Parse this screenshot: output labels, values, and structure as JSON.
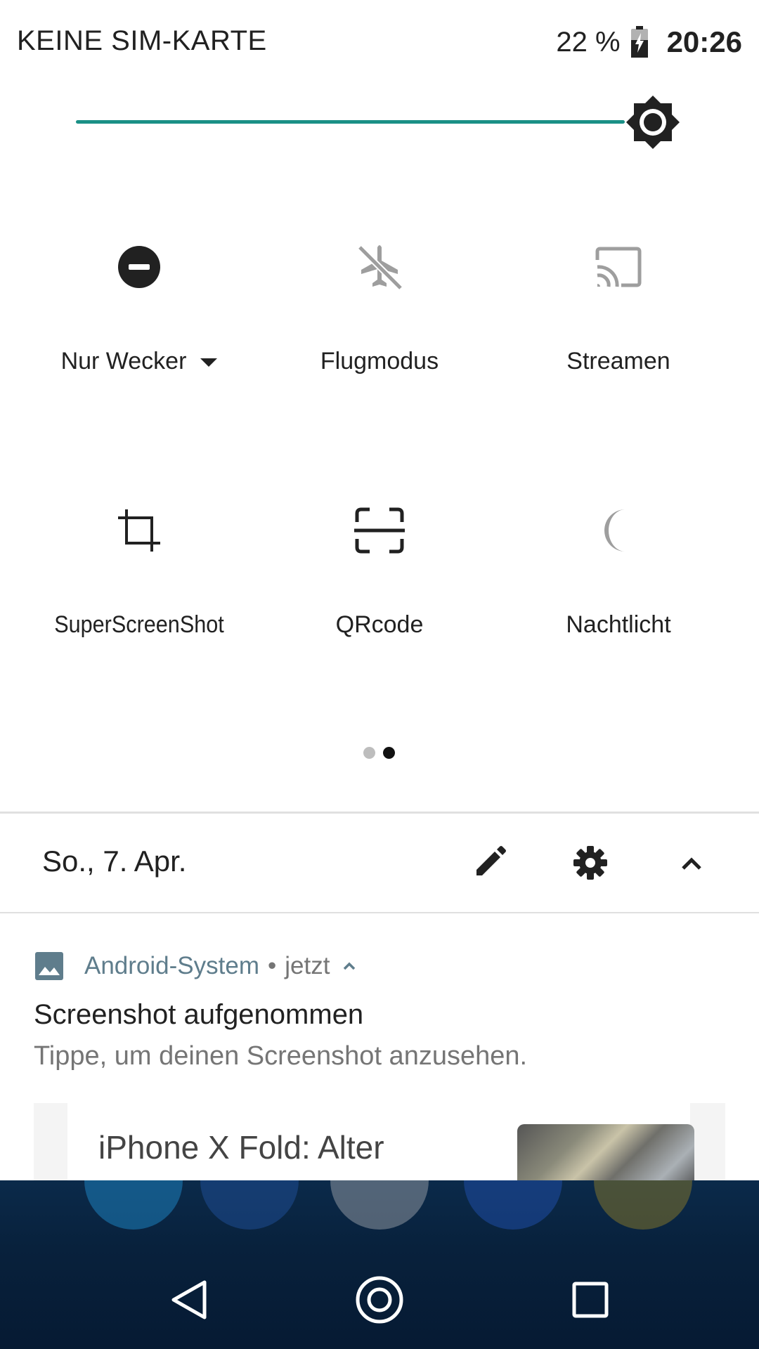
{
  "status_bar": {
    "carrier": "KEINE SIM-KARTE",
    "battery_percent": "22 %",
    "battery_level": 0.22,
    "battery_icon": "battery-charging-icon",
    "time": "20:26"
  },
  "brightness": {
    "level": 0.95,
    "icon": "brightness-icon",
    "accent_color": "#1a9086"
  },
  "tiles": [
    {
      "label": "Nur Wecker",
      "icon": "do-not-disturb-icon",
      "active": true,
      "has_dropdown": true
    },
    {
      "label": "Flugmodus",
      "icon": "airplane-off-icon",
      "active": false
    },
    {
      "label": "Streamen",
      "icon": "cast-icon",
      "active": false
    },
    {
      "label": "SuperScreenShot",
      "icon": "crop-icon",
      "active": true
    },
    {
      "label": "QRcode",
      "icon": "qr-scan-icon",
      "active": true
    },
    {
      "label": "Nachtlicht",
      "icon": "moon-icon",
      "active": false
    }
  ],
  "pager": {
    "pages": 2,
    "current": 2
  },
  "footer": {
    "date": "So., 7. Apr.",
    "edit_icon": "pencil-icon",
    "settings_icon": "gear-icon",
    "collapse_icon": "chevron-up-icon"
  },
  "notification": {
    "app_icon": "image-icon",
    "app_name": "Android-System",
    "separator": "•",
    "time": "jetzt",
    "expand_icon": "chevron-up-icon",
    "title": "Screenshot aufgenommen",
    "text": "Tippe, um deinen Screenshot anzusehen.",
    "preview_text": "iPhone X Fold: Alter"
  },
  "nav_bar": {
    "back_icon": "back-triangle-icon",
    "home_icon": "home-circle-icon",
    "recents_icon": "recents-square-icon"
  }
}
